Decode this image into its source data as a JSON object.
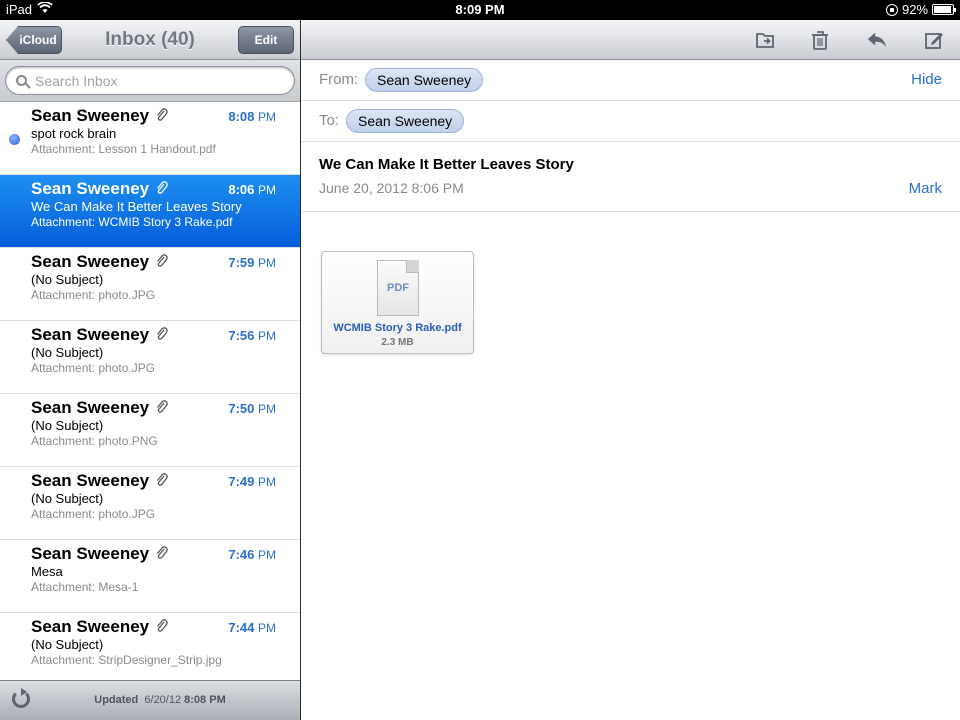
{
  "status": {
    "device": "iPad",
    "time": "8:09 PM",
    "battery": "92",
    "battery_suffix": "%",
    "battery_level": 0.92
  },
  "mailbox": {
    "back_label": "iCloud",
    "title": "Inbox (40)",
    "edit_label": "Edit",
    "search_placeholder": "Search Inbox"
  },
  "messages": [
    {
      "sender": "Sean Sweeney",
      "time": "8:08",
      "ampm": "PM",
      "subject": "spot rock brain",
      "preview": "Attachment: Lesson 1 Handout.pdf",
      "unread": true,
      "selected": false
    },
    {
      "sender": "Sean Sweeney",
      "time": "8:06",
      "ampm": "PM",
      "subject": "We Can Make It Better Leaves Story",
      "preview": "Attachment: WCMIB Story 3 Rake.pdf",
      "unread": false,
      "selected": true
    },
    {
      "sender": "Sean Sweeney",
      "time": "7:59",
      "ampm": "PM",
      "subject": "(No Subject)",
      "preview": "Attachment: photo.JPG",
      "unread": false,
      "selected": false
    },
    {
      "sender": "Sean Sweeney",
      "time": "7:56",
      "ampm": "PM",
      "subject": "(No Subject)",
      "preview": "Attachment: photo.JPG",
      "unread": false,
      "selected": false
    },
    {
      "sender": "Sean Sweeney",
      "time": "7:50",
      "ampm": "PM",
      "subject": "(No Subject)",
      "preview": "Attachment: photo.PNG",
      "unread": false,
      "selected": false
    },
    {
      "sender": "Sean Sweeney",
      "time": "7:49",
      "ampm": "PM",
      "subject": "(No Subject)",
      "preview": "Attachment: photo.JPG",
      "unread": false,
      "selected": false
    },
    {
      "sender": "Sean Sweeney",
      "time": "7:46",
      "ampm": "PM",
      "subject": "Mesa",
      "preview": "Attachment: Mesa-1",
      "unread": false,
      "selected": false
    },
    {
      "sender": "Sean Sweeney",
      "time": "7:44",
      "ampm": "PM",
      "subject": "(No Subject)",
      "preview": "Attachment: StripDesigner_Strip.jpg",
      "unread": false,
      "selected": false
    }
  ],
  "footer": {
    "updated_label": "Updated",
    "updated_date": "6/20/12",
    "updated_time": "8:08 PM"
  },
  "detail": {
    "from_label": "From:",
    "from_name": "Sean Sweeney",
    "hide_label": "Hide",
    "to_label": "To:",
    "to_name": "Sean Sweeney",
    "subject": "We Can Make It Better Leaves Story",
    "date": "June 20, 2012 8:06 PM",
    "mark_label": "Mark",
    "attachment": {
      "type_label": "PDF",
      "name": "WCMIB Story 3 Rake.pdf",
      "size": "2.3 MB"
    }
  },
  "toolbar_icons": [
    "move-to-folder-icon",
    "trash-icon",
    "reply-icon",
    "compose-icon"
  ],
  "colors": {
    "accent_blue": "#2a6ecd",
    "selection_blue": "#1d8ff0"
  }
}
